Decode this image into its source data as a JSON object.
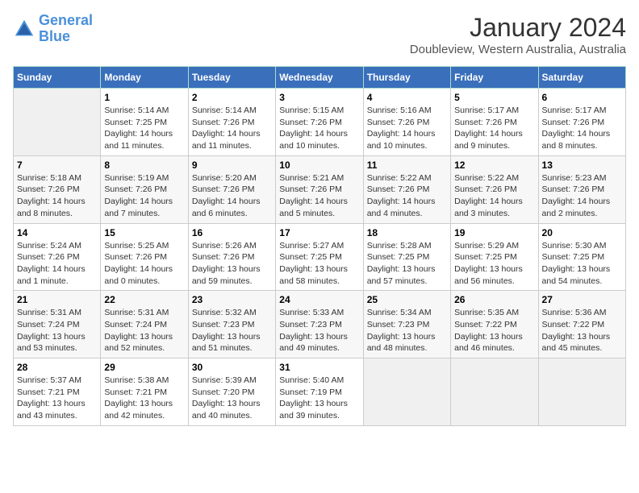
{
  "logo": {
    "line1": "General",
    "line2": "Blue"
  },
  "title": "January 2024",
  "subtitle": "Doubleview, Western Australia, Australia",
  "days_header": [
    "Sunday",
    "Monday",
    "Tuesday",
    "Wednesday",
    "Thursday",
    "Friday",
    "Saturday"
  ],
  "weeks": [
    [
      {
        "num": "",
        "info": ""
      },
      {
        "num": "1",
        "info": "Sunrise: 5:14 AM\nSunset: 7:25 PM\nDaylight: 14 hours\nand 11 minutes."
      },
      {
        "num": "2",
        "info": "Sunrise: 5:14 AM\nSunset: 7:26 PM\nDaylight: 14 hours\nand 11 minutes."
      },
      {
        "num": "3",
        "info": "Sunrise: 5:15 AM\nSunset: 7:26 PM\nDaylight: 14 hours\nand 10 minutes."
      },
      {
        "num": "4",
        "info": "Sunrise: 5:16 AM\nSunset: 7:26 PM\nDaylight: 14 hours\nand 10 minutes."
      },
      {
        "num": "5",
        "info": "Sunrise: 5:17 AM\nSunset: 7:26 PM\nDaylight: 14 hours\nand 9 minutes."
      },
      {
        "num": "6",
        "info": "Sunrise: 5:17 AM\nSunset: 7:26 PM\nDaylight: 14 hours\nand 8 minutes."
      }
    ],
    [
      {
        "num": "7",
        "info": "Sunrise: 5:18 AM\nSunset: 7:26 PM\nDaylight: 14 hours\nand 8 minutes."
      },
      {
        "num": "8",
        "info": "Sunrise: 5:19 AM\nSunset: 7:26 PM\nDaylight: 14 hours\nand 7 minutes."
      },
      {
        "num": "9",
        "info": "Sunrise: 5:20 AM\nSunset: 7:26 PM\nDaylight: 14 hours\nand 6 minutes."
      },
      {
        "num": "10",
        "info": "Sunrise: 5:21 AM\nSunset: 7:26 PM\nDaylight: 14 hours\nand 5 minutes."
      },
      {
        "num": "11",
        "info": "Sunrise: 5:22 AM\nSunset: 7:26 PM\nDaylight: 14 hours\nand 4 minutes."
      },
      {
        "num": "12",
        "info": "Sunrise: 5:22 AM\nSunset: 7:26 PM\nDaylight: 14 hours\nand 3 minutes."
      },
      {
        "num": "13",
        "info": "Sunrise: 5:23 AM\nSunset: 7:26 PM\nDaylight: 14 hours\nand 2 minutes."
      }
    ],
    [
      {
        "num": "14",
        "info": "Sunrise: 5:24 AM\nSunset: 7:26 PM\nDaylight: 14 hours\nand 1 minute."
      },
      {
        "num": "15",
        "info": "Sunrise: 5:25 AM\nSunset: 7:26 PM\nDaylight: 14 hours\nand 0 minutes."
      },
      {
        "num": "16",
        "info": "Sunrise: 5:26 AM\nSunset: 7:26 PM\nDaylight: 13 hours\nand 59 minutes."
      },
      {
        "num": "17",
        "info": "Sunrise: 5:27 AM\nSunset: 7:25 PM\nDaylight: 13 hours\nand 58 minutes."
      },
      {
        "num": "18",
        "info": "Sunrise: 5:28 AM\nSunset: 7:25 PM\nDaylight: 13 hours\nand 57 minutes."
      },
      {
        "num": "19",
        "info": "Sunrise: 5:29 AM\nSunset: 7:25 PM\nDaylight: 13 hours\nand 56 minutes."
      },
      {
        "num": "20",
        "info": "Sunrise: 5:30 AM\nSunset: 7:25 PM\nDaylight: 13 hours\nand 54 minutes."
      }
    ],
    [
      {
        "num": "21",
        "info": "Sunrise: 5:31 AM\nSunset: 7:24 PM\nDaylight: 13 hours\nand 53 minutes."
      },
      {
        "num": "22",
        "info": "Sunrise: 5:31 AM\nSunset: 7:24 PM\nDaylight: 13 hours\nand 52 minutes."
      },
      {
        "num": "23",
        "info": "Sunrise: 5:32 AM\nSunset: 7:23 PM\nDaylight: 13 hours\nand 51 minutes."
      },
      {
        "num": "24",
        "info": "Sunrise: 5:33 AM\nSunset: 7:23 PM\nDaylight: 13 hours\nand 49 minutes."
      },
      {
        "num": "25",
        "info": "Sunrise: 5:34 AM\nSunset: 7:23 PM\nDaylight: 13 hours\nand 48 minutes."
      },
      {
        "num": "26",
        "info": "Sunrise: 5:35 AM\nSunset: 7:22 PM\nDaylight: 13 hours\nand 46 minutes."
      },
      {
        "num": "27",
        "info": "Sunrise: 5:36 AM\nSunset: 7:22 PM\nDaylight: 13 hours\nand 45 minutes."
      }
    ],
    [
      {
        "num": "28",
        "info": "Sunrise: 5:37 AM\nSunset: 7:21 PM\nDaylight: 13 hours\nand 43 minutes."
      },
      {
        "num": "29",
        "info": "Sunrise: 5:38 AM\nSunset: 7:21 PM\nDaylight: 13 hours\nand 42 minutes."
      },
      {
        "num": "30",
        "info": "Sunrise: 5:39 AM\nSunset: 7:20 PM\nDaylight: 13 hours\nand 40 minutes."
      },
      {
        "num": "31",
        "info": "Sunrise: 5:40 AM\nSunset: 7:19 PM\nDaylight: 13 hours\nand 39 minutes."
      },
      {
        "num": "",
        "info": ""
      },
      {
        "num": "",
        "info": ""
      },
      {
        "num": "",
        "info": ""
      }
    ]
  ]
}
